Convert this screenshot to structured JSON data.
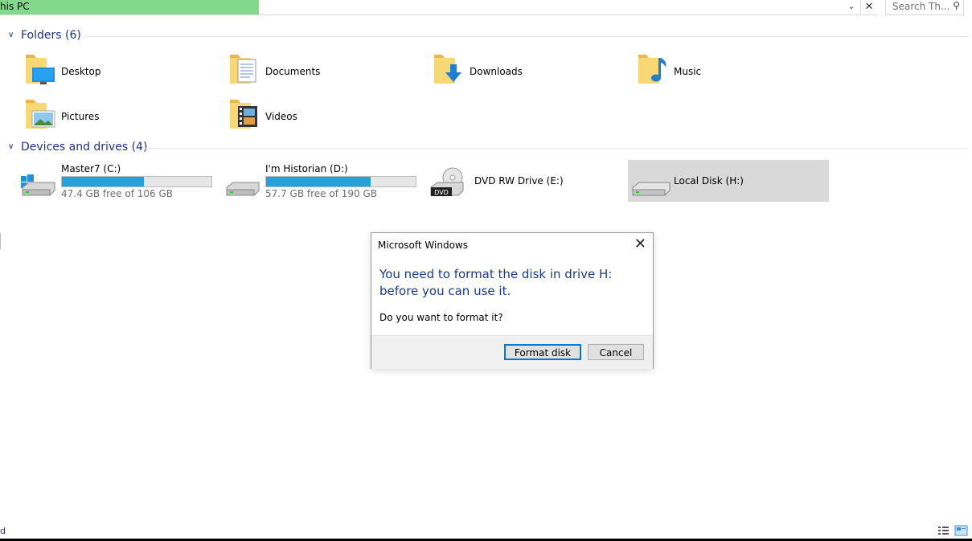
{
  "address": {
    "text": "his PC",
    "progress": 0.266
  },
  "search": {
    "placeholder": "Search Th..."
  },
  "folders_section": {
    "title": "Folders (6)"
  },
  "folders": [
    {
      "name": "Desktop"
    },
    {
      "name": "Documents"
    },
    {
      "name": "Downloads"
    },
    {
      "name": "Music"
    },
    {
      "name": "Pictures"
    },
    {
      "name": "Videos"
    }
  ],
  "drives_section": {
    "title": "Devices and drives (4)"
  },
  "drives": [
    {
      "name": "Master7 (C:)",
      "free": "47.4 GB free of 106 GB",
      "used_fraction": 0.55
    },
    {
      "name": "I'm Historian (D:)",
      "free": "57.7 GB free of 190 GB",
      "used_fraction": 0.7
    },
    {
      "name": "DVD RW Drive (E:)",
      "badge": "DVD"
    },
    {
      "name": "Local Disk (H:)"
    }
  ],
  "dialog": {
    "title": "Microsoft Windows",
    "message": "You need to format the disk in drive H: before you can use it.",
    "question": "Do you want to format it?",
    "format_label": "Format disk",
    "cancel_label": "Cancel"
  },
  "status": {
    "left_text": "d"
  },
  "colors": {
    "accent": "#1e3287",
    "progress_fill": "#26a0da",
    "address_progress": "#83d98b"
  }
}
